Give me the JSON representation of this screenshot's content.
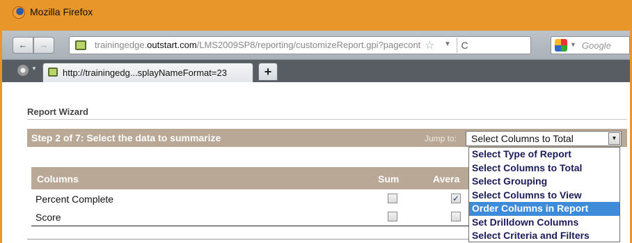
{
  "window": {
    "title": "Mozilla Firefox"
  },
  "nav": {
    "back_label": "←",
    "forward_label": "→",
    "url_prefix": "trainingedge.",
    "url_domain": "outstart.com",
    "url_path": "/LMS2009SP8/reporting/customizeReport.gpi?pagecont",
    "reload_label": "C",
    "search_placeholder": "Google"
  },
  "tabs": {
    "active_title": "http://trainingedg...splayNameFormat=23",
    "new_tab_label": "+"
  },
  "wizard": {
    "title": "Report Wizard",
    "step_text": "Step 2 of 7:  Select the data to summarize",
    "jump_label": "Jump to:",
    "jump_selected": "Select Columns to Total",
    "jump_options": [
      "Select Type of Report",
      "Select Columns to Total",
      "Select Grouping",
      "Select Columns to View",
      "Order Columns in Report",
      "Set Drilldown Columns",
      "Select Criteria and Filters"
    ],
    "highlighted_option": "Order Columns in Report"
  },
  "table": {
    "headers": {
      "columns": "Columns",
      "sum": "Sum",
      "average": "Avera"
    },
    "rows": [
      {
        "label": "Percent Complete",
        "sum": false,
        "average": true
      },
      {
        "label": "Score",
        "sum": false,
        "average": false
      }
    ]
  },
  "colors": {
    "accent": "#e8952a",
    "header_bg": "#b9a895",
    "highlight": "#3d8bd9"
  }
}
